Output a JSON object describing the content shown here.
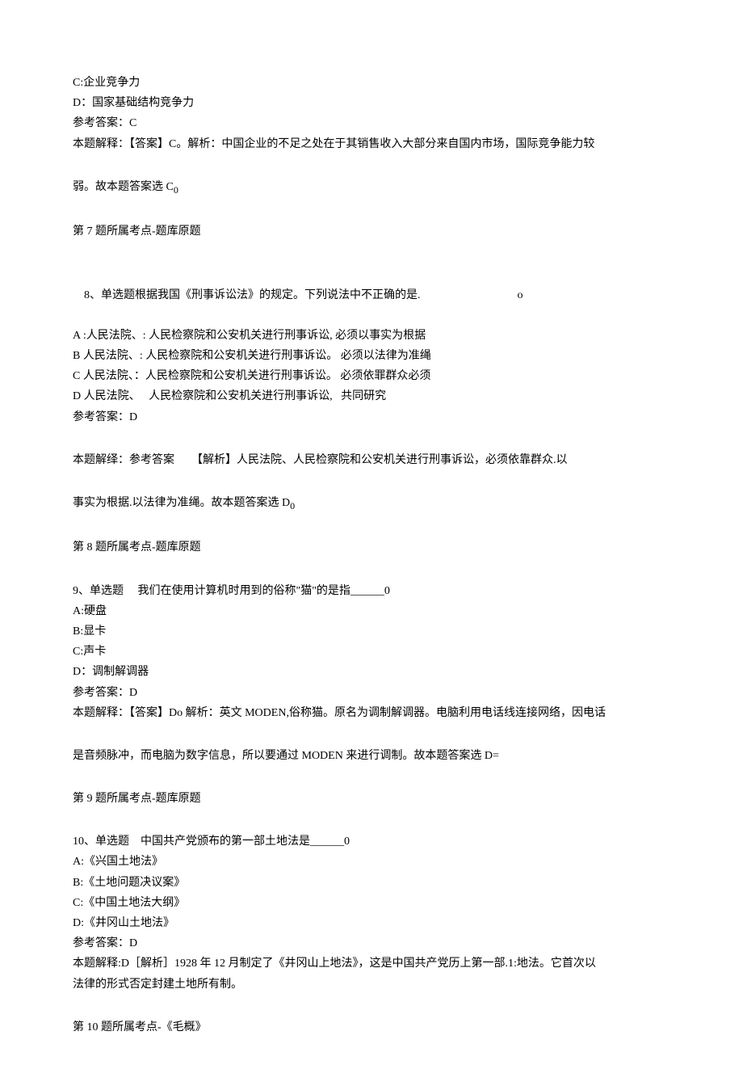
{
  "q7_tail": {
    "optC": "C:企业竞争力",
    "optD": "D：国家基础结构竞争力",
    "ref": "参考答案：C",
    "expl1": "本题解释：【答案】C。解析：中国企业的不足之处在于其销售收入大部分来自国内市场，国际竞争能力较",
    "expl2_a": "弱。故本题答案选 C",
    "expl2_b": "0",
    "tag": "第 7 题所属考点-题库原题"
  },
  "q8": {
    "stem_a": "8、单选题根据我国《刑事诉讼法》的规定。下列说法中不正确的是.",
    "stem_b": "o",
    "optA": "A :人民法院、: 人民检察院和公安机关进行刑事诉讼, 必须以事实为根据",
    "optB": "B 人民法院、: 人民检察院和公安机关进行刑事诉讼。 必须以法律为准绳",
    "optC": "C 人民法院、：人民检察院和公安机关进行刑事诉讼。 必须依罪群众必须",
    "optD": "D 人民法院、   人民检察院和公安机关进行刑事诉讼,   共同研究",
    "ref": "参考答案：D",
    "expl1": "本题解绎：参考答案      【解析】人民法院、人民检察院和公安机关进行刑事诉讼，必须依靠群众.以",
    "expl2_a": "事实为根据.以法律为准绳。故本题答案选 D",
    "expl2_b": "0",
    "tag": "第 8 题所属考点-题库原题"
  },
  "q9": {
    "stem": "9、单选题     我们在使用计算机时用到的俗称\"猫\"的是指______0",
    "optA": "A:硬盘",
    "optB": "B:显卡",
    "optC": "C:声卡",
    "optD": "D：调制解调器",
    "ref": "参考答案：D",
    "expl1": "本题解释：【答案】Do 解析：英文 MODEN,俗称猫。原名为调制解调器。电脑利用电话线连接网络，因电话",
    "expl2": "是音频脉冲，而电脑为数字信息，所以要通过 MODEN 来进行调制。故本题答案选 D=",
    "tag": "第 9 题所属考点-题库原题"
  },
  "q10": {
    "stem": "10、单选题    中国共产党颁布的第一部土地法是______0",
    "optA": "A:《兴国土地法》",
    "optB": "B:《土地问题决议案》",
    "optC": "C:《中国土地法大纲》",
    "optD": "D:《井冈山土地法》",
    "ref": "参考答案：D",
    "expl1": "本题解释:D［解析］1928 年 12 月制定了《井冈山上地法》，这是中国共产党历上第一部.1:地法。它首次以",
    "expl2": "法律的形式否定封建土地所有制。",
    "tag": "第 10 题所属考点-《毛概》"
  }
}
